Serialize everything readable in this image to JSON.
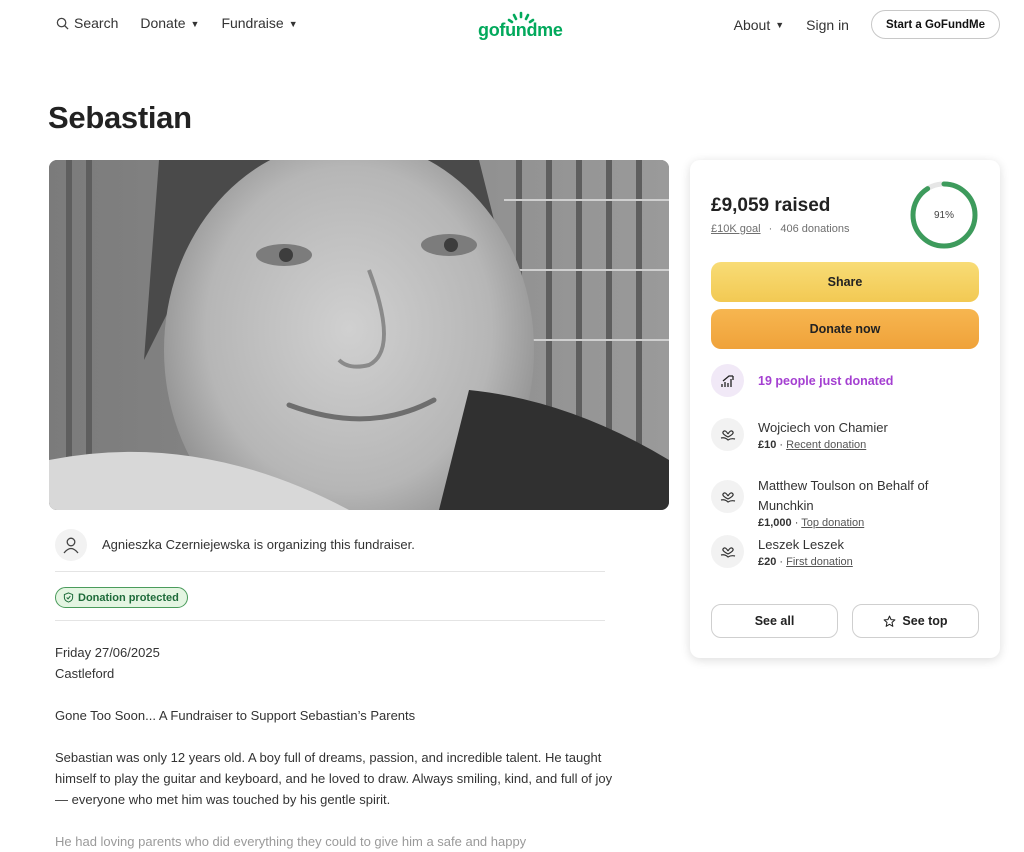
{
  "header": {
    "search_label": "Search",
    "donate_label": "Donate",
    "fundraise_label": "Fundraise",
    "logo_text": "gofundme",
    "about_label": "About",
    "signin_label": "Sign in",
    "start_label": "Start a GoFundMe",
    "brand_color": "#02a95c"
  },
  "page": {
    "title": "Sebastian"
  },
  "organizer": {
    "text": "Agnieszka Czerniejewska is organizing this fundraiser."
  },
  "badge": {
    "label": "Donation protected"
  },
  "story": {
    "date": "Friday 27/06/2025",
    "place": "Castleford",
    "headline": "Gone Too Soon... A Fundraiser to Support Sebastian’s Parents",
    "para1": "Sebastian was only 12 years old. A boy full of dreams, passion, and incredible talent. He taught himself to play the guitar and keyboard, and he loved to draw. Always smiling, kind, and full of joy — everyone who met him was touched by his gentle spirit.",
    "para2": "He had loving parents who did everything they could to give him a safe and happy"
  },
  "card": {
    "raised": "£9,059 raised",
    "goal": "£10K goal",
    "separator": "·",
    "donations": "406 donations",
    "progress_percent": 91,
    "progress_label": "91%",
    "progress_color": "#3d9b5c",
    "share_label": "Share",
    "donate_label": "Donate now",
    "trend_text": "19 people just donated",
    "donors": [
      {
        "name": "Wojciech von Chamier",
        "amount": "£10",
        "tag": "Recent donation"
      },
      {
        "name": "Matthew Toulson on Behalf of Munchkin",
        "amount": "£1,000",
        "tag": "Top donation"
      },
      {
        "name": "Leszek Leszek",
        "amount": "£20",
        "tag": "First donation"
      }
    ],
    "see_all_label": "See all",
    "see_top_label": "See top"
  }
}
